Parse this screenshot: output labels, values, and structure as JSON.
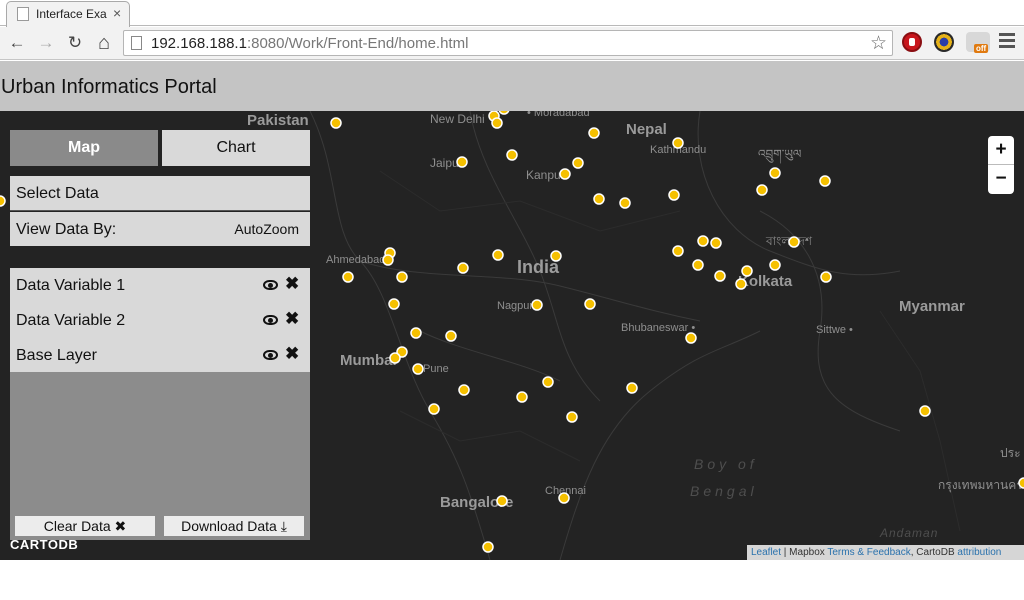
{
  "browser": {
    "tab_title": "Interface Exa",
    "tab_close": "×",
    "url_host": "192.168.188.1",
    "url_rest": ":8080/Work/Front-End/home.html",
    "back": "←",
    "forward": "→",
    "reload": "↻",
    "home": "⌂",
    "star": "☆",
    "extension_badge": "off"
  },
  "app": {
    "title": "Urban Informatics Portal"
  },
  "panel": {
    "tabs": [
      {
        "label": "Map",
        "active": true
      },
      {
        "label": "Chart",
        "active": false
      }
    ],
    "select_data": "Select Data",
    "view_by_label": "View Data By:",
    "view_by_value": "AutoZoom",
    "layers": [
      {
        "name": "Data Variable 1"
      },
      {
        "name": "Data Variable 2"
      },
      {
        "name": "Base Layer"
      }
    ],
    "remove_glyph": "✖",
    "clear_button": "Clear Data ✖",
    "download_button": "Download Data ⤓"
  },
  "map": {
    "zoom_in": "+",
    "zoom_out": "−",
    "cartodb_logo": "CARTODB",
    "attribution": {
      "leaflet": "Leaflet",
      "sep1": " | Mapbox ",
      "terms": "Terms & Feedback",
      "sep2": ", CartoDB ",
      "attr": "attribution"
    },
    "labels": {
      "pakistan": "Pakistan",
      "new_delhi": "New Delhi",
      "moradabad": "• Moradabad",
      "nepal": "Nepal",
      "kathmandu": "Kathmandu",
      "jaipur": "Jaipur",
      "kanpur": "Kanpur",
      "india": "India",
      "ahmedabad": "Ahmedabad",
      "nagpur": "Nagpur",
      "kolkata": "Kolkata",
      "bhubaneswar": "Bhubaneswar •",
      "myanmar": "Myanmar",
      "sittwe": "Sittwe •",
      "mumbai": "Mumbai",
      "pune": "Pune",
      "bay_of": "Boy of",
      "bengal": "Bengal",
      "bangalore": "Bangalore",
      "chennai": "Chennai",
      "andaman": "Andaman",
      "bangladesh": "বাংলাদেশ",
      "bhutan": "འབྲུག་ཡུལ",
      "thailand": "กรุงเทพมหานคร",
      "thai_prefix": "ประ"
    },
    "point_color": "#f5c000"
  }
}
